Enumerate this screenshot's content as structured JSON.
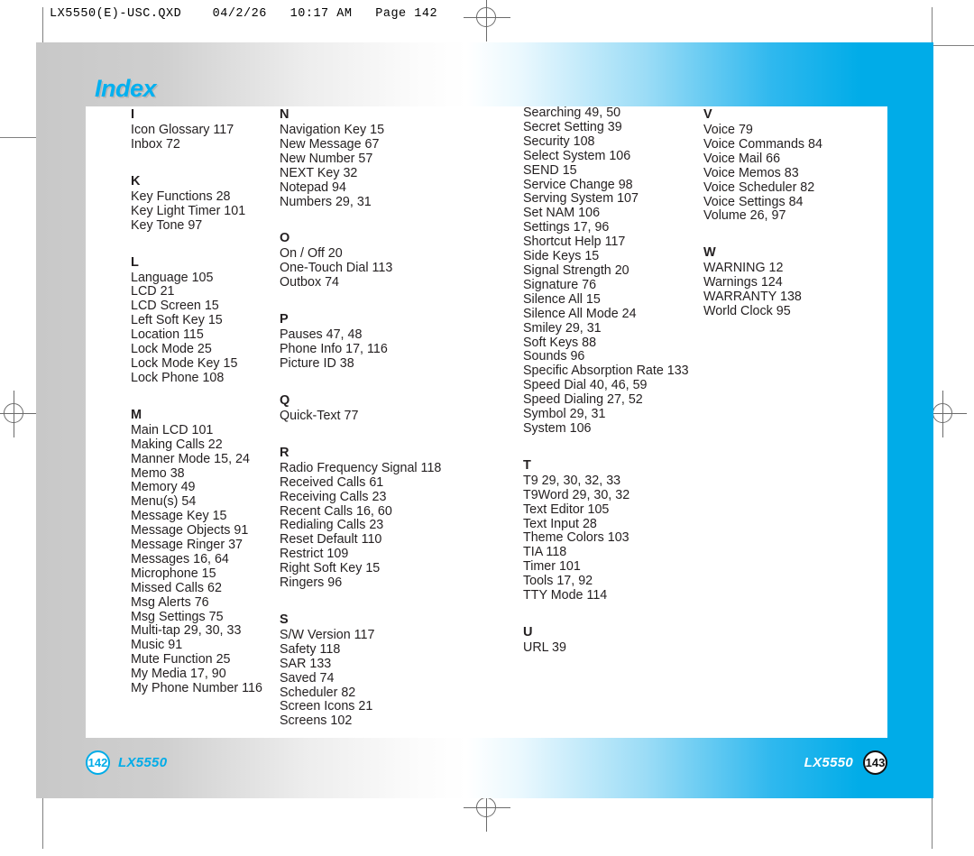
{
  "prepress": {
    "header_line": "LX5550(E)-USC.QXD    04/2/26   10:17 AM   Page 142"
  },
  "page": {
    "title": "Index",
    "title_color": "#00b0f0",
    "accent_color": "#00ace8"
  },
  "footer": {
    "left_page_number": "142",
    "left_model": "LX5550",
    "right_model": "LX5550",
    "right_page_number": "143"
  },
  "index": {
    "columns": [
      {
        "groups": [
          {
            "letter": "I",
            "entries": [
              "Icon Glossary 117",
              "Inbox 72"
            ]
          },
          {
            "letter": "K",
            "entries": [
              "Key Functions 28",
              "Key Light Timer 101",
              "Key Tone 97"
            ]
          },
          {
            "letter": "L",
            "entries": [
              "Language 105",
              "LCD 21",
              "LCD Screen 15",
              "Left Soft Key 15",
              "Location 115",
              "Lock Mode 25",
              "Lock Mode Key 15",
              "Lock Phone 108"
            ]
          },
          {
            "letter": "M",
            "entries": [
              "Main LCD 101",
              "Making Calls 22",
              "Manner Mode 15, 24",
              "Memo 38",
              "Memory 49",
              "Menu(s) 54",
              "Message Key 15",
              "Message Objects 91",
              "Message Ringer 37",
              "Messages 16, 64",
              "Microphone 15",
              "Missed Calls 62",
              "Msg Alerts 76",
              "Msg Settings 75",
              "Multi-tap 29, 30, 33",
              "Music 91",
              "Mute Function 25",
              "My Media 17, 90",
              "My Phone Number 116"
            ]
          }
        ]
      },
      {
        "groups": [
          {
            "letter": "N",
            "entries": [
              "Navigation Key 15",
              "New Message 67",
              "New Number 57",
              "NEXT Key 32",
              "Notepad 94",
              "Numbers 29, 31"
            ]
          },
          {
            "letter": "O",
            "entries": [
              "On / Off 20",
              "One-Touch Dial 113",
              "Outbox 74"
            ]
          },
          {
            "letter": "P",
            "entries": [
              "Pauses 47, 48",
              "Phone Info 17, 116",
              "Picture ID 38"
            ]
          },
          {
            "letter": "Q",
            "entries": [
              "Quick-Text 77"
            ]
          },
          {
            "letter": "R",
            "entries": [
              "Radio Frequency Signal 118",
              "Received Calls 61",
              "Receiving Calls 23",
              "Recent Calls 16, 60",
              "Redialing Calls 23",
              "Reset Default 110",
              "Restrict 109",
              "Right Soft Key 15",
              "Ringers 96"
            ]
          },
          {
            "letter": "S",
            "entries": [
              "S/W Version 117",
              "Safety 118",
              "SAR 133",
              "Saved 74",
              "Scheduler 82",
              "Screen Icons 21",
              "Screens 102"
            ]
          }
        ]
      },
      {
        "groups": [
          {
            "letter": "",
            "continuation": true,
            "entries": [
              "Searching 49, 50",
              "Secret Setting 39",
              "Security 108",
              "Select System 106",
              "SEND 15",
              "Service Change 98",
              "Serving System 107",
              "Set NAM 106",
              "Settings 17, 96",
              "Shortcut Help 117",
              "Side Keys 15",
              "Signal Strength 20",
              "Signature 76",
              "Silence All 15",
              "Silence All Mode 24",
              "Smiley 29, 31",
              "Soft Keys 88",
              "Sounds 96",
              "Specific Absorption Rate 133",
              "Speed Dial 40, 46, 59",
              "Speed Dialing 27, 52",
              "Symbol 29, 31",
              "System 106"
            ]
          },
          {
            "letter": "T",
            "entries": [
              "T9 29, 30, 32, 33",
              "T9Word 29, 30, 32",
              "Text Editor 105",
              "Text Input 28",
              "Theme Colors 103",
              "TIA 118",
              "Timer 101",
              "Tools 17, 92",
              "TTY Mode 114"
            ]
          },
          {
            "letter": "U",
            "entries": [
              "URL 39"
            ]
          }
        ]
      },
      {
        "groups": [
          {
            "letter": "V",
            "entries": [
              "Voice 79",
              "Voice Commands 84",
              "Voice Mail 66",
              "Voice Memos 83",
              "Voice Scheduler 82",
              "Voice Settings 84",
              "Volume 26, 97"
            ]
          },
          {
            "letter": "W",
            "entries": [
              "WARNING 12",
              "Warnings 124",
              "WARRANTY 138",
              "World Clock 95"
            ]
          }
        ]
      }
    ]
  }
}
